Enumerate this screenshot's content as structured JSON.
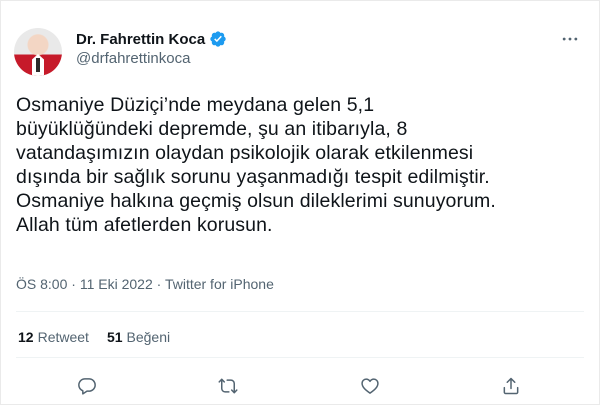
{
  "author": {
    "name": "Dr. Fahrettin Koca",
    "handle": "@drfahrettinkoca",
    "verified": true
  },
  "tweet": {
    "text": "Osmaniye Düziçi’nde meydana gelen 5,1\nbüyüklüğündeki depremde, şu an itibarıyla, 8\nvatandaşımızın olaydan psikolojik olarak etkilenmesi\ndışında bir sağlık sorunu yaşanmadığı tespit edilmiştir.\nOsmaniye halkına geçmiş olsun dileklerimi sunuyorum.\nAllah tüm afetlerden korusun.",
    "time": "ÖS 8:00",
    "separator": "·",
    "date": "11 Eki 2022",
    "source": "Twitter for iPhone"
  },
  "stats": {
    "retweets_count": "12",
    "retweets_label": "Retweet",
    "likes_count": "51",
    "likes_label": "Beğeni"
  },
  "colors": {
    "text": "#0f1419",
    "secondary": "#536471",
    "verified": "#1d9bf0",
    "divider": "#eff3f4"
  },
  "icons": {
    "more": "more-dots-icon",
    "reply": "reply-icon",
    "retweet": "retweet-icon",
    "like": "heart-icon",
    "share": "share-icon",
    "verified": "verified-badge-icon"
  }
}
